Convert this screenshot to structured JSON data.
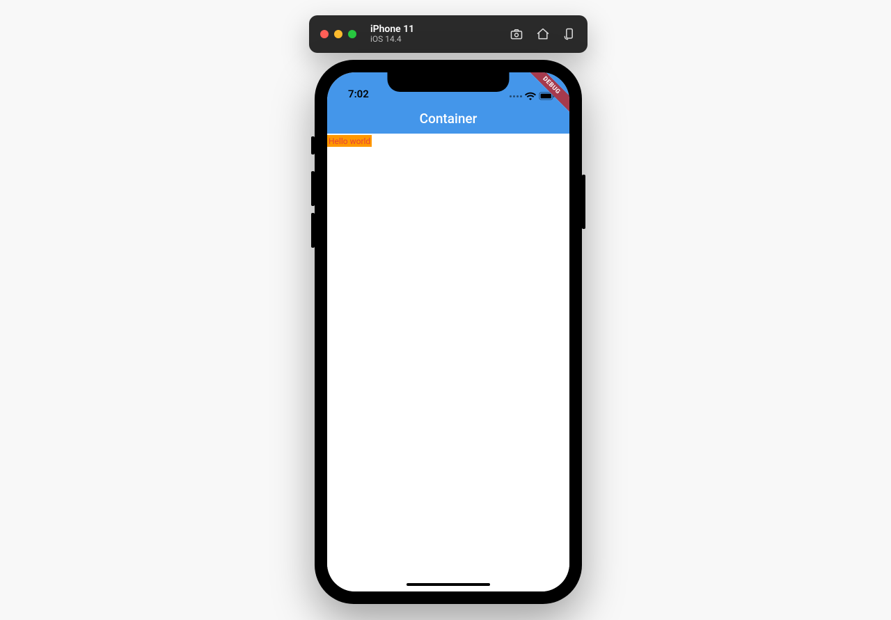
{
  "simulator": {
    "device_name": "iPhone 11",
    "os_version": "iOS 14.4",
    "icons": {
      "screenshot": "screenshot-icon",
      "home": "home-icon",
      "rotate": "rotate-icon"
    }
  },
  "status_bar": {
    "time": "7:02"
  },
  "app": {
    "appbar_title": "Container",
    "body_text": "Hello world",
    "debug_banner": "DEBUG",
    "colors": {
      "primary": "#4496ea",
      "box_bg": "#ff9800",
      "box_text": "#e54138",
      "debug_banner": "#a63a4d"
    }
  }
}
